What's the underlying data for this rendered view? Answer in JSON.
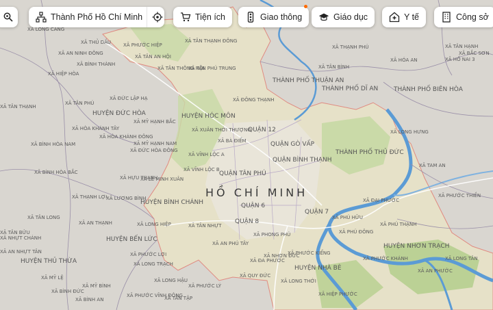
{
  "toolbar": {
    "location": "Thành Phố Hồ Chí Minh",
    "categories": [
      {
        "label": "Tiện ích",
        "icon": "cart-icon"
      },
      {
        "label": "Giao thông",
        "icon": "traffic-light-icon",
        "badge": true
      },
      {
        "label": "Giáo dục",
        "icon": "graduation-cap-icon"
      },
      {
        "label": "Y tế",
        "icon": "hospital-icon"
      },
      {
        "label": "Công sở",
        "icon": "office-building-icon"
      }
    ]
  },
  "map": {
    "city_label": "HỒ CHÍ MINH",
    "colors": {
      "region_fill": "#e6e1c8",
      "region_border": "#e08a80",
      "river": "#5b9bd5",
      "green": "#b6cf8f",
      "background": "#d9d6d0"
    },
    "districts": [
      "HUYỆN HÓC MÔN",
      "QUẬN 12",
      "QUẬN GÒ VẤP",
      "QUẬN BÌNH THẠNH",
      "QUẬN TÂN PHÚ",
      "QUẬN 6",
      "QUẬN 8",
      "QUẬN 7",
      "HUYỆN BÌNH CHÁNH",
      "HUYỆN NHÀ BÈ",
      "THÀNH PHỐ THỦ ĐỨC",
      "THÀNH PHỐ THUẬN AN",
      "THÀNH PHỐ DĨ AN",
      "THÀNH PHỐ BIÊN HÒA",
      "HUYỆN ĐỨC HÒA",
      "HUYỆN BẾN LỨC",
      "HUYỆN THỦ THỪA",
      "HUYỆN NHƠN TRẠCH"
    ],
    "communes": [
      "XÃ TÂN THẠNH ĐÔNG",
      "XÃ PHƯỚC HIỆP",
      "XÃ TÂN AN HỘI",
      "XÃ TÂN THÔNG HỘI",
      "XÃ TÂN PHÚ TRUNG",
      "XÃ ĐÔNG THẠNH",
      "XÃ XUÂN THỚI THƯỢNG",
      "XÃ BÀ ĐIỂM",
      "XÃ VĨNH LỘC A",
      "XÃ VĨNH LỘC B",
      "XÃ LÊ MINH XUÂN",
      "XÃ TÂN NHỰT",
      "XÃ AN PHÚ TÂY",
      "XÃ PHONG PHÚ",
      "XÃ ĐA PHƯỚC",
      "XÃ QUY ĐỨC",
      "XÃ NHƠN ĐỨC",
      "XÃ LONG THỚI",
      "XÃ HIỆP PHƯỚC",
      "XÃ PHƯỚC KIỂNG",
      "XÃ ĐỨC LẬP HẠ",
      "XÃ MỸ HẠNH BẮC",
      "XÃ MỸ HẠNH NAM",
      "XÃ ĐỨC HÒA ĐÔNG",
      "XÃ HỰU THẠNH",
      "XÃ LƯƠNG BÌNH",
      "XÃ LONG HIỆP",
      "XÃ THẠNH LỢI",
      "XÃ TÂN BỬU",
      "XÃ AN THẠNH",
      "XÃ PHƯỚC LỢI",
      "XÃ LONG TRẠCH",
      "XÃ LONG HẬU",
      "XÃ BÌNH AN",
      "XÃ TAM AN",
      "XÃ ĐẠI PHƯỚC",
      "XÃ PHÚ HỮU",
      "XÃ PHÚ THẠNH",
      "XÃ PHÚ ĐÔNG",
      "XÃ PHƯỚC KHÁNH",
      "XÃ LONG TÂN",
      "XÃ PHƯỚC THIỀN",
      "XÃ AN PHƯỚC",
      "XÃ LONG HƯNG",
      "XÃ HÓA AN",
      "XÃ TÂN HẠNH",
      "XÃ BẮC SƠN",
      "XÃ HỐ NAI 3",
      "XÃ THẠNH PHÚ",
      "XÃ TÂN BÌNH",
      "XÃ TÂN THẠNH",
      "XÃ MỸ LỆ",
      "XÃ HIỆP HÒA",
      "XÃ AN NINH ĐÔNG",
      "XÃ BÌNH HÒA NAM",
      "XÃ BÌNH THÀNH",
      "XÃ TÂN PHÚ",
      "XÃ HÒA KHÁNH TÂY",
      "XÃ HÒA KHÁNH ĐÔNG",
      "XÃ BÌNH HÒA BẮC",
      "XÃ TÂN LONG",
      "XÃ NHỰT CHÁNH",
      "XÃ AN NHỰT TÂN",
      "XÃ BÌNH ĐỨC",
      "XÃ MỸ BÌNH",
      "XÃ LONG CANG",
      "XÃ THỦ DẦU",
      "XÃ PHƯỚC VĨNH ĐÔNG",
      "XÃ TÂN TẬP",
      "XÃ PHƯỚC LÝ"
    ]
  }
}
